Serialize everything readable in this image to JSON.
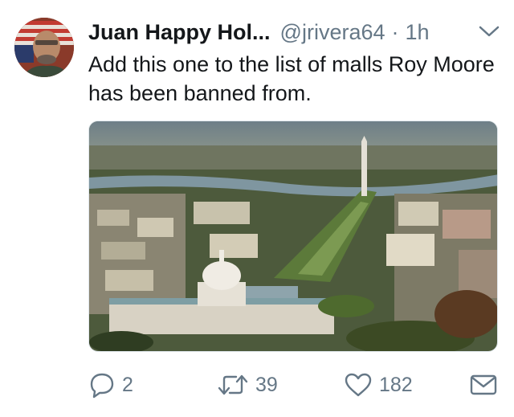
{
  "tweet": {
    "author_name": "Juan Happy Hol...",
    "handle": "@jrivera64",
    "separator": "·",
    "time": "1h",
    "text": "Add this one to the list of malls Roy Moore has been banned from."
  },
  "actions": {
    "replies": "2",
    "retweets": "39",
    "likes": "182"
  },
  "icons": {
    "reply": "reply-icon",
    "retweet": "retweet-icon",
    "like": "heart-icon",
    "message": "envelope-icon",
    "menu": "chevron-down-icon"
  },
  "colors": {
    "text": "#14171a",
    "muted": "#657786"
  }
}
